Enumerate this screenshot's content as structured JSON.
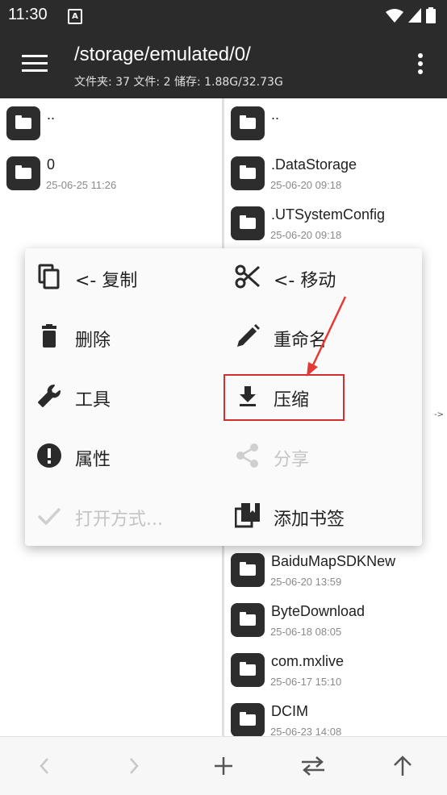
{
  "status": {
    "time": "11:30"
  },
  "toolbar": {
    "path": "/storage/emulated/0/",
    "summary": "文件夹: 37  文件: 2  储存: 1.88G/32.73G"
  },
  "left_pane": {
    "items": [
      {
        "name": "..",
        "date": ""
      },
      {
        "name": "0",
        "date": "25-06-25 11:26"
      }
    ]
  },
  "right_pane": {
    "items": [
      {
        "name": "..",
        "date": ""
      },
      {
        "name": ".DataStorage",
        "date": "25-06-20 09:18"
      },
      {
        "name": ".UTSystemConfig",
        "date": "25-06-20 09:18"
      },
      {
        "name": "BaiduMapSDKNew",
        "date": "25-06-20 13:59"
      },
      {
        "name": "ByteDownload",
        "date": "25-06-18 08:05"
      },
      {
        "name": "com.mxlive",
        "date": "25-06-17 15:10"
      },
      {
        "name": "DCIM",
        "date": "25-06-23 14:08"
      }
    ],
    "hint": "->"
  },
  "menu": {
    "copy": "<- 复制",
    "move": "<- 移动",
    "delete": "删除",
    "rename": "重命名",
    "tools": "工具",
    "compress": "压缩",
    "properties": "属性",
    "share": "分享",
    "open_with": "打开方式...",
    "add_bookmark": "添加书签"
  },
  "colors": {
    "bar": "#2b2b2b",
    "highlight": "#d32f2f",
    "disabled": "#c4c4c4"
  }
}
